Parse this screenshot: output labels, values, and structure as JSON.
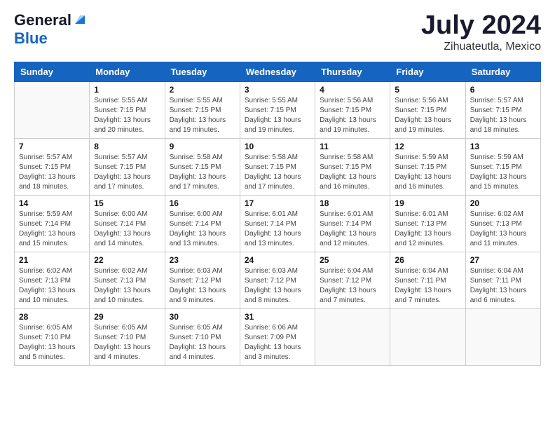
{
  "header": {
    "logo_general": "General",
    "logo_blue": "Blue",
    "month_title": "July 2024",
    "location": "Zihuateutla, Mexico"
  },
  "columns": [
    "Sunday",
    "Monday",
    "Tuesday",
    "Wednesday",
    "Thursday",
    "Friday",
    "Saturday"
  ],
  "weeks": [
    [
      {
        "day": "",
        "info": ""
      },
      {
        "day": "1",
        "info": "Sunrise: 5:55 AM\nSunset: 7:15 PM\nDaylight: 13 hours\nand 20 minutes."
      },
      {
        "day": "2",
        "info": "Sunrise: 5:55 AM\nSunset: 7:15 PM\nDaylight: 13 hours\nand 19 minutes."
      },
      {
        "day": "3",
        "info": "Sunrise: 5:55 AM\nSunset: 7:15 PM\nDaylight: 13 hours\nand 19 minutes."
      },
      {
        "day": "4",
        "info": "Sunrise: 5:56 AM\nSunset: 7:15 PM\nDaylight: 13 hours\nand 19 minutes."
      },
      {
        "day": "5",
        "info": "Sunrise: 5:56 AM\nSunset: 7:15 PM\nDaylight: 13 hours\nand 19 minutes."
      },
      {
        "day": "6",
        "info": "Sunrise: 5:57 AM\nSunset: 7:15 PM\nDaylight: 13 hours\nand 18 minutes."
      }
    ],
    [
      {
        "day": "7",
        "info": "Sunrise: 5:57 AM\nSunset: 7:15 PM\nDaylight: 13 hours\nand 18 minutes."
      },
      {
        "day": "8",
        "info": "Sunrise: 5:57 AM\nSunset: 7:15 PM\nDaylight: 13 hours\nand 17 minutes."
      },
      {
        "day": "9",
        "info": "Sunrise: 5:58 AM\nSunset: 7:15 PM\nDaylight: 13 hours\nand 17 minutes."
      },
      {
        "day": "10",
        "info": "Sunrise: 5:58 AM\nSunset: 7:15 PM\nDaylight: 13 hours\nand 17 minutes."
      },
      {
        "day": "11",
        "info": "Sunrise: 5:58 AM\nSunset: 7:15 PM\nDaylight: 13 hours\nand 16 minutes."
      },
      {
        "day": "12",
        "info": "Sunrise: 5:59 AM\nSunset: 7:15 PM\nDaylight: 13 hours\nand 16 minutes."
      },
      {
        "day": "13",
        "info": "Sunrise: 5:59 AM\nSunset: 7:15 PM\nDaylight: 13 hours\nand 15 minutes."
      }
    ],
    [
      {
        "day": "14",
        "info": "Sunrise: 5:59 AM\nSunset: 7:14 PM\nDaylight: 13 hours\nand 15 minutes."
      },
      {
        "day": "15",
        "info": "Sunrise: 6:00 AM\nSunset: 7:14 PM\nDaylight: 13 hours\nand 14 minutes."
      },
      {
        "day": "16",
        "info": "Sunrise: 6:00 AM\nSunset: 7:14 PM\nDaylight: 13 hours\nand 13 minutes."
      },
      {
        "day": "17",
        "info": "Sunrise: 6:01 AM\nSunset: 7:14 PM\nDaylight: 13 hours\nand 13 minutes."
      },
      {
        "day": "18",
        "info": "Sunrise: 6:01 AM\nSunset: 7:14 PM\nDaylight: 13 hours\nand 12 minutes."
      },
      {
        "day": "19",
        "info": "Sunrise: 6:01 AM\nSunset: 7:13 PM\nDaylight: 13 hours\nand 12 minutes."
      },
      {
        "day": "20",
        "info": "Sunrise: 6:02 AM\nSunset: 7:13 PM\nDaylight: 13 hours\nand 11 minutes."
      }
    ],
    [
      {
        "day": "21",
        "info": "Sunrise: 6:02 AM\nSunset: 7:13 PM\nDaylight: 13 hours\nand 10 minutes."
      },
      {
        "day": "22",
        "info": "Sunrise: 6:02 AM\nSunset: 7:13 PM\nDaylight: 13 hours\nand 10 minutes."
      },
      {
        "day": "23",
        "info": "Sunrise: 6:03 AM\nSunset: 7:12 PM\nDaylight: 13 hours\nand 9 minutes."
      },
      {
        "day": "24",
        "info": "Sunrise: 6:03 AM\nSunset: 7:12 PM\nDaylight: 13 hours\nand 8 minutes."
      },
      {
        "day": "25",
        "info": "Sunrise: 6:04 AM\nSunset: 7:12 PM\nDaylight: 13 hours\nand 7 minutes."
      },
      {
        "day": "26",
        "info": "Sunrise: 6:04 AM\nSunset: 7:11 PM\nDaylight: 13 hours\nand 7 minutes."
      },
      {
        "day": "27",
        "info": "Sunrise: 6:04 AM\nSunset: 7:11 PM\nDaylight: 13 hours\nand 6 minutes."
      }
    ],
    [
      {
        "day": "28",
        "info": "Sunrise: 6:05 AM\nSunset: 7:10 PM\nDaylight: 13 hours\nand 5 minutes."
      },
      {
        "day": "29",
        "info": "Sunrise: 6:05 AM\nSunset: 7:10 PM\nDaylight: 13 hours\nand 4 minutes."
      },
      {
        "day": "30",
        "info": "Sunrise: 6:05 AM\nSunset: 7:10 PM\nDaylight: 13 hours\nand 4 minutes."
      },
      {
        "day": "31",
        "info": "Sunrise: 6:06 AM\nSunset: 7:09 PM\nDaylight: 13 hours\nand 3 minutes."
      },
      {
        "day": "",
        "info": ""
      },
      {
        "day": "",
        "info": ""
      },
      {
        "day": "",
        "info": ""
      }
    ]
  ]
}
